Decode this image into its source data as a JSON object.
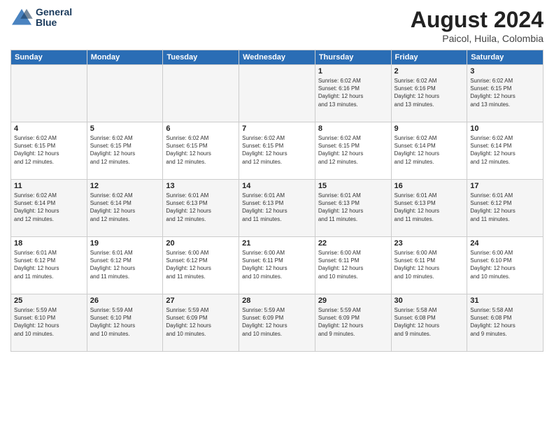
{
  "header": {
    "logo_line1": "General",
    "logo_line2": "Blue",
    "title": "August 2024",
    "subtitle": "Paicol, Huila, Colombia"
  },
  "days_of_week": [
    "Sunday",
    "Monday",
    "Tuesday",
    "Wednesday",
    "Thursday",
    "Friday",
    "Saturday"
  ],
  "weeks": [
    [
      {
        "day": "",
        "info": ""
      },
      {
        "day": "",
        "info": ""
      },
      {
        "day": "",
        "info": ""
      },
      {
        "day": "",
        "info": ""
      },
      {
        "day": "1",
        "info": "Sunrise: 6:02 AM\nSunset: 6:16 PM\nDaylight: 12 hours\nand 13 minutes."
      },
      {
        "day": "2",
        "info": "Sunrise: 6:02 AM\nSunset: 6:16 PM\nDaylight: 12 hours\nand 13 minutes."
      },
      {
        "day": "3",
        "info": "Sunrise: 6:02 AM\nSunset: 6:15 PM\nDaylight: 12 hours\nand 13 minutes."
      }
    ],
    [
      {
        "day": "4",
        "info": "Sunrise: 6:02 AM\nSunset: 6:15 PM\nDaylight: 12 hours\nand 12 minutes."
      },
      {
        "day": "5",
        "info": "Sunrise: 6:02 AM\nSunset: 6:15 PM\nDaylight: 12 hours\nand 12 minutes."
      },
      {
        "day": "6",
        "info": "Sunrise: 6:02 AM\nSunset: 6:15 PM\nDaylight: 12 hours\nand 12 minutes."
      },
      {
        "day": "7",
        "info": "Sunrise: 6:02 AM\nSunset: 6:15 PM\nDaylight: 12 hours\nand 12 minutes."
      },
      {
        "day": "8",
        "info": "Sunrise: 6:02 AM\nSunset: 6:15 PM\nDaylight: 12 hours\nand 12 minutes."
      },
      {
        "day": "9",
        "info": "Sunrise: 6:02 AM\nSunset: 6:14 PM\nDaylight: 12 hours\nand 12 minutes."
      },
      {
        "day": "10",
        "info": "Sunrise: 6:02 AM\nSunset: 6:14 PM\nDaylight: 12 hours\nand 12 minutes."
      }
    ],
    [
      {
        "day": "11",
        "info": "Sunrise: 6:02 AM\nSunset: 6:14 PM\nDaylight: 12 hours\nand 12 minutes."
      },
      {
        "day": "12",
        "info": "Sunrise: 6:02 AM\nSunset: 6:14 PM\nDaylight: 12 hours\nand 12 minutes."
      },
      {
        "day": "13",
        "info": "Sunrise: 6:01 AM\nSunset: 6:13 PM\nDaylight: 12 hours\nand 12 minutes."
      },
      {
        "day": "14",
        "info": "Sunrise: 6:01 AM\nSunset: 6:13 PM\nDaylight: 12 hours\nand 11 minutes."
      },
      {
        "day": "15",
        "info": "Sunrise: 6:01 AM\nSunset: 6:13 PM\nDaylight: 12 hours\nand 11 minutes."
      },
      {
        "day": "16",
        "info": "Sunrise: 6:01 AM\nSunset: 6:13 PM\nDaylight: 12 hours\nand 11 minutes."
      },
      {
        "day": "17",
        "info": "Sunrise: 6:01 AM\nSunset: 6:12 PM\nDaylight: 12 hours\nand 11 minutes."
      }
    ],
    [
      {
        "day": "18",
        "info": "Sunrise: 6:01 AM\nSunset: 6:12 PM\nDaylight: 12 hours\nand 11 minutes."
      },
      {
        "day": "19",
        "info": "Sunrise: 6:01 AM\nSunset: 6:12 PM\nDaylight: 12 hours\nand 11 minutes."
      },
      {
        "day": "20",
        "info": "Sunrise: 6:00 AM\nSunset: 6:12 PM\nDaylight: 12 hours\nand 11 minutes."
      },
      {
        "day": "21",
        "info": "Sunrise: 6:00 AM\nSunset: 6:11 PM\nDaylight: 12 hours\nand 10 minutes."
      },
      {
        "day": "22",
        "info": "Sunrise: 6:00 AM\nSunset: 6:11 PM\nDaylight: 12 hours\nand 10 minutes."
      },
      {
        "day": "23",
        "info": "Sunrise: 6:00 AM\nSunset: 6:11 PM\nDaylight: 12 hours\nand 10 minutes."
      },
      {
        "day": "24",
        "info": "Sunrise: 6:00 AM\nSunset: 6:10 PM\nDaylight: 12 hours\nand 10 minutes."
      }
    ],
    [
      {
        "day": "25",
        "info": "Sunrise: 5:59 AM\nSunset: 6:10 PM\nDaylight: 12 hours\nand 10 minutes."
      },
      {
        "day": "26",
        "info": "Sunrise: 5:59 AM\nSunset: 6:10 PM\nDaylight: 12 hours\nand 10 minutes."
      },
      {
        "day": "27",
        "info": "Sunrise: 5:59 AM\nSunset: 6:09 PM\nDaylight: 12 hours\nand 10 minutes."
      },
      {
        "day": "28",
        "info": "Sunrise: 5:59 AM\nSunset: 6:09 PM\nDaylight: 12 hours\nand 10 minutes."
      },
      {
        "day": "29",
        "info": "Sunrise: 5:59 AM\nSunset: 6:09 PM\nDaylight: 12 hours\nand 9 minutes."
      },
      {
        "day": "30",
        "info": "Sunrise: 5:58 AM\nSunset: 6:08 PM\nDaylight: 12 hours\nand 9 minutes."
      },
      {
        "day": "31",
        "info": "Sunrise: 5:58 AM\nSunset: 6:08 PM\nDaylight: 12 hours\nand 9 minutes."
      }
    ]
  ]
}
